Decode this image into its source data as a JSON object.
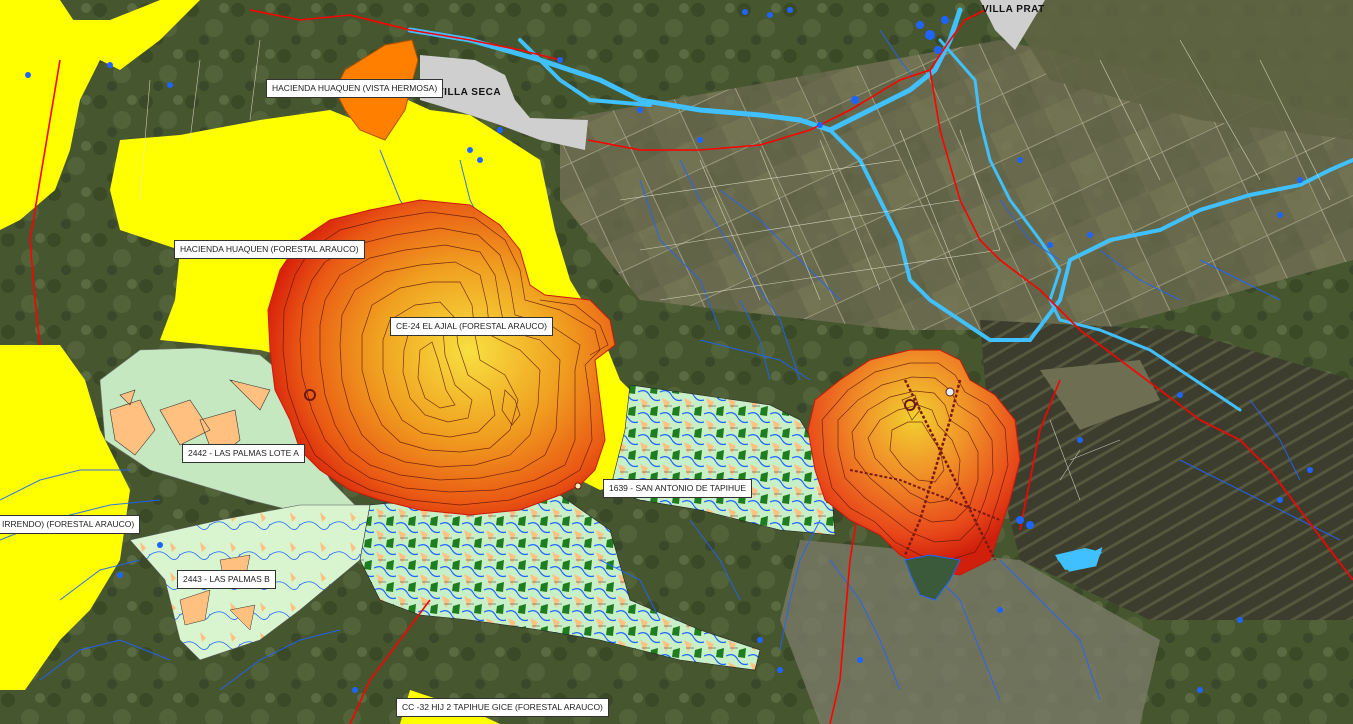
{
  "towns": {
    "villa_prat": "VILLA PRAT",
    "villa_seca": "VILLA SECA"
  },
  "labels": {
    "hacienda_vista_hermosa": "HACIENDA HUAQUEN (VISTA HERMOSA)",
    "hacienda_forestal": "HACIENDA HUAQUEN (FORESTAL ARAUCO)",
    "ce24": "CE-24 EL AJIAL (FORESTAL ARAUCO)",
    "lote_a": "2442 - LAS PALMAS LOTE A",
    "san_antonio": "1639 - SAN ANTONIO DE TAPIHUE",
    "forestal_left": "IRRENDO) (FORESTAL ARAUCO)",
    "las_palmas_b": "2443 - LAS PALMAS B",
    "cc32": "CC -32 HIJ 2 TAPIHUE GICE (FORESTAL ARAUCO)"
  },
  "legend_colors": {
    "forestry_property": "#ffff00",
    "urban_area": "#d0d0d0",
    "small_parcel": "#ff8000",
    "river": "#40c0ff",
    "road": "#ff0000",
    "waterbody_point": "#1e64ff",
    "fire_contour_outer": "#e82810",
    "fire_contour_inner": "#f8d830"
  }
}
